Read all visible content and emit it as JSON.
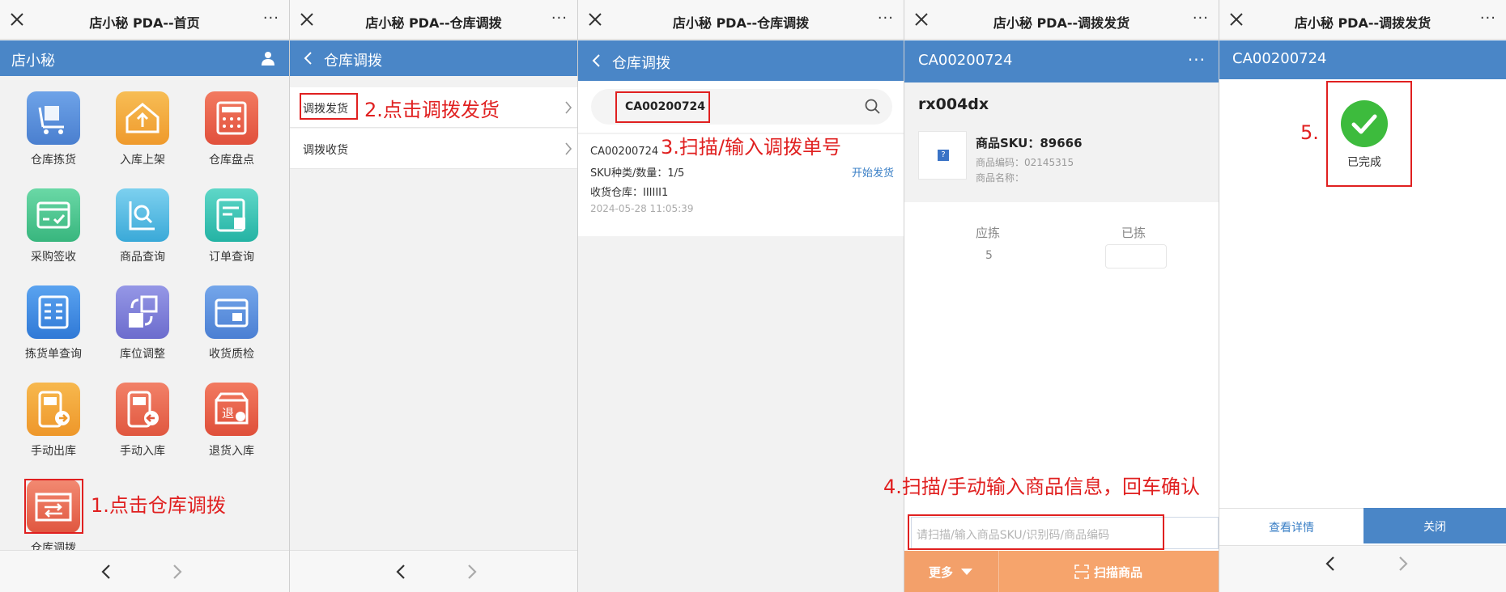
{
  "panel1": {
    "title": "店小秘 PDA--首页",
    "bar_title": "店小秘",
    "items": [
      {
        "label": "仓库拣货",
        "icon": "cart-icon",
        "color": "#5a8fd6"
      },
      {
        "label": "入库上架",
        "icon": "house-upload-icon",
        "color": "#f3a93b"
      },
      {
        "label": "仓库盘点",
        "icon": "calculator-icon",
        "color": "#e8604a"
      },
      {
        "label": "采购签收",
        "icon": "sign-check-icon",
        "color": "#4fc48f"
      },
      {
        "label": "商品查询",
        "icon": "search-doc-icon",
        "color": "#49b6e0"
      },
      {
        "label": "订单查询",
        "icon": "order-doc-icon",
        "color": "#2fc0b3"
      },
      {
        "label": "拣货单查询",
        "icon": "grid-list-icon",
        "color": "#3f8ee8"
      },
      {
        "label": "库位调整",
        "icon": "swap-boxes-icon",
        "color": "#7d7fd8"
      },
      {
        "label": "收货质检",
        "icon": "inbox-check-icon",
        "color": "#5b8fdd"
      },
      {
        "label": "手动出库",
        "icon": "device-out-icon",
        "color": "#f3a33a"
      },
      {
        "label": "手动入库",
        "icon": "device-in-icon",
        "color": "#e8674e"
      },
      {
        "label": "退货入库",
        "icon": "return-stamp-icon",
        "color": "#e6604a"
      },
      {
        "label": "仓库调拨",
        "icon": "transfer-icon",
        "color": "#e8644c"
      }
    ],
    "step": "1.点击仓库调拨"
  },
  "panel2": {
    "title": "店小秘 PDA--仓库调拨",
    "back_label": "仓库调拨",
    "rows": [
      "调拨发货",
      "调拨收货"
    ],
    "step": "2.点击调拨发货"
  },
  "panel3": {
    "title": "店小秘 PDA--仓库调拨",
    "back_label": "仓库调拨",
    "search_value": "CA00200724",
    "card": {
      "order_no": "CA00200724",
      "sku_line": "SKU种类/数量：1/5",
      "warehouse_line": "收货仓库：IIIIII1",
      "time": "2024-05-28 11:05:39",
      "action": "开始发货"
    },
    "step": "3.扫描/输入调拨单号"
  },
  "panel4": {
    "title": "店小秘 PDA--调拨发货",
    "bar_title": "CA00200724",
    "product_name": "rx004dx",
    "sku_line": "商品SKU：89666",
    "code_line": "商品编码：02145315",
    "name_line": "商品名称：",
    "col_should": "应拣",
    "col_done": "已拣",
    "should_value": "5",
    "input_placeholder": "请扫描/输入商品SKU/识别码/商品编码",
    "more_label": "更多",
    "scan_label": "扫描商品",
    "step": "4.扫描/手动输入商品信息，回车确认"
  },
  "panel5": {
    "title": "店小秘 PDA--调拨发货",
    "bar_title": "CA00200724",
    "status": "已完成",
    "step": "5.",
    "detail_label": "查看详情",
    "close_label": "关闭"
  }
}
